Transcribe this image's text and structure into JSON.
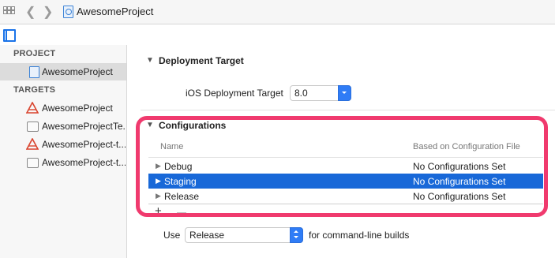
{
  "toolbar": {
    "breadcrumb": "AwesomeProject",
    "icons": [
      "grid-icon",
      "back-chevron-icon",
      "forward-chevron-icon",
      "project-file-icon"
    ]
  },
  "sidebar": {
    "project_header": "PROJECT",
    "project_item": "AwesomeProject",
    "targets_header": "TARGETS",
    "targets": [
      {
        "label": "AwesomeProject",
        "icon": "app-target-icon"
      },
      {
        "label": "AwesomeProjectTe...",
        "icon": "test-target-icon"
      },
      {
        "label": "AwesomeProject-t...",
        "icon": "app-target-icon"
      },
      {
        "label": "AwesomeProject-t...",
        "icon": "test-target-icon"
      }
    ]
  },
  "deployment": {
    "title": "Deployment Target",
    "label": "iOS Deployment Target",
    "value": "8.0"
  },
  "configurations": {
    "title": "Configurations",
    "col_name": "Name",
    "col_file": "Based on Configuration File",
    "rows": [
      {
        "name": "Debug",
        "file": "No Configurations Set",
        "selected": false
      },
      {
        "name": "Staging",
        "file": "No Configurations Set",
        "selected": true
      },
      {
        "name": "Release",
        "file": "No Configurations Set",
        "selected": false
      }
    ],
    "add_label": "+",
    "remove_label": "—"
  },
  "commandline": {
    "use_label": "Use",
    "value": "Release",
    "suffix": "for command-line builds"
  },
  "colors": {
    "selection": "#1868d8",
    "highlight": "#f03a6e",
    "accent": "#2f7cf6"
  }
}
